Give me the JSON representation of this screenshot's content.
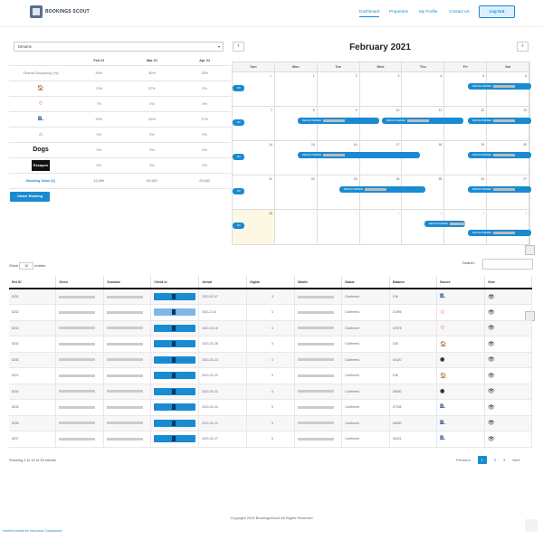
{
  "nav": {
    "brand": "BOOKINGS SCOUT",
    "links": [
      "Dashboard",
      "Properties",
      "My Profile",
      "Contact Us"
    ],
    "login": "Log Out"
  },
  "property_select": "Dreams",
  "occupancy": {
    "months": [
      "Feb 21",
      "Mar 21",
      "Apr 21"
    ],
    "overall_label": "Overall Occupancy (%)",
    "overall": [
      "40%",
      "40%",
      "33%"
    ],
    "rows": [
      {
        "source": "Tripadvisor",
        "icon": "tripadvisor-icon",
        "values": [
          "74%",
          "57%",
          "2%"
        ]
      },
      {
        "source": "Airbnb",
        "icon": "airbnb-icon",
        "values": [
          "7%",
          "0%",
          "0%"
        ]
      },
      {
        "source": "Booking.com",
        "icon": "booking-icon",
        "values": [
          "39%",
          "20%",
          "27%"
        ]
      },
      {
        "source": "Holiday",
        "icon": "holiday-icon",
        "values": [
          "0%",
          "0%",
          "0%"
        ]
      },
      {
        "source": "Dogs",
        "icon": "dogs-logo",
        "values": [
          "0%",
          "0%",
          "0%"
        ]
      },
      {
        "source": "Escapes",
        "icon": "escapes-logo",
        "values": [
          "0%",
          "0%",
          "0%"
        ]
      }
    ],
    "booking_value_label": "Booking Value (£)",
    "booking_value": [
      "£3,589",
      "£5,683",
      "£5,683"
    ]
  },
  "owner_btn": "Owner Booking",
  "calendar": {
    "title": "February 2021",
    "days": [
      "Sun",
      "Mon",
      "Tue",
      "Wed",
      "Thu",
      "Fri",
      "Sat"
    ],
    "weeks": [
      [
        "31",
        "1",
        "2",
        "3",
        "4",
        "5",
        "6"
      ],
      [
        "7",
        "8",
        "9",
        "10",
        "11",
        "12",
        "13"
      ],
      [
        "14",
        "15",
        "16",
        "17",
        "18",
        "19",
        "20"
      ],
      [
        "21",
        "22",
        "23",
        "24",
        "25",
        "26",
        "27"
      ],
      [
        "28",
        "1",
        "2",
        "3",
        "4",
        "5",
        "6"
      ]
    ],
    "event_label": "RESULOVEDEH",
    "event_short": "R3"
  },
  "table": {
    "show": "Show",
    "entries_val": "10",
    "entries": "entries",
    "search": "Search:",
    "headers": [
      "Res ID",
      "Given",
      "Surname",
      "Check In",
      "Arrival",
      "Nights",
      "Mobile",
      "Status",
      "Balance",
      "Source",
      "View"
    ],
    "rows": [
      {
        "id": "8231",
        "arrival": "2021-02-07",
        "nights": "3",
        "status": "Confirmed",
        "balance": "£36",
        "source": "B."
      },
      {
        "id": "8232",
        "arrival": "2021-2-16",
        "nights": "3",
        "status": "Confirmed",
        "balance": "£1096",
        "source": "A"
      },
      {
        "id": "8233",
        "arrival": "2021-02-16",
        "nights": "3",
        "status": "Confirmed",
        "balance": "£2978",
        "source": "A"
      },
      {
        "id": "8234",
        "arrival": "2021-02-28",
        "nights": "3",
        "status": "Confirmed",
        "balance": "£36",
        "source": "T"
      },
      {
        "id": "8235",
        "arrival": "2021-02-23",
        "nights": "3",
        "status": "Confirmed",
        "balance": "£6420",
        "source": "O"
      },
      {
        "id": "8221",
        "arrival": "2021-02-22",
        "nights": "3",
        "status": "Confirmed",
        "balance": "£36",
        "source": "T"
      },
      {
        "id": "8234",
        "arrival": "2021-02-22",
        "nights": "4",
        "status": "Confirmed",
        "balance": "£8630",
        "source": "O"
      },
      {
        "id": "8235",
        "arrival": "2021-02-24",
        "nights": "3",
        "status": "Confirmed",
        "balance": "£7206",
        "source": "B."
      },
      {
        "id": "8236",
        "arrival": "2021-02-12",
        "nights": "3",
        "status": "Confirmed",
        "balance": "£6630",
        "source": "B."
      },
      {
        "id": "8237",
        "arrival": "2021-02-17",
        "nights": "3",
        "status": "Confirmed",
        "balance": "£6401",
        "source": "B."
      }
    ],
    "info": "Showing 1 to 10 of 25 entries",
    "pager": [
      "Previous",
      "1",
      "2",
      "3",
      "Next"
    ]
  },
  "footer": {
    "copyright": "Copyright 2020 BookingsScout All Rights Reserved",
    "property": "Verified results for Insurance Compliance"
  }
}
